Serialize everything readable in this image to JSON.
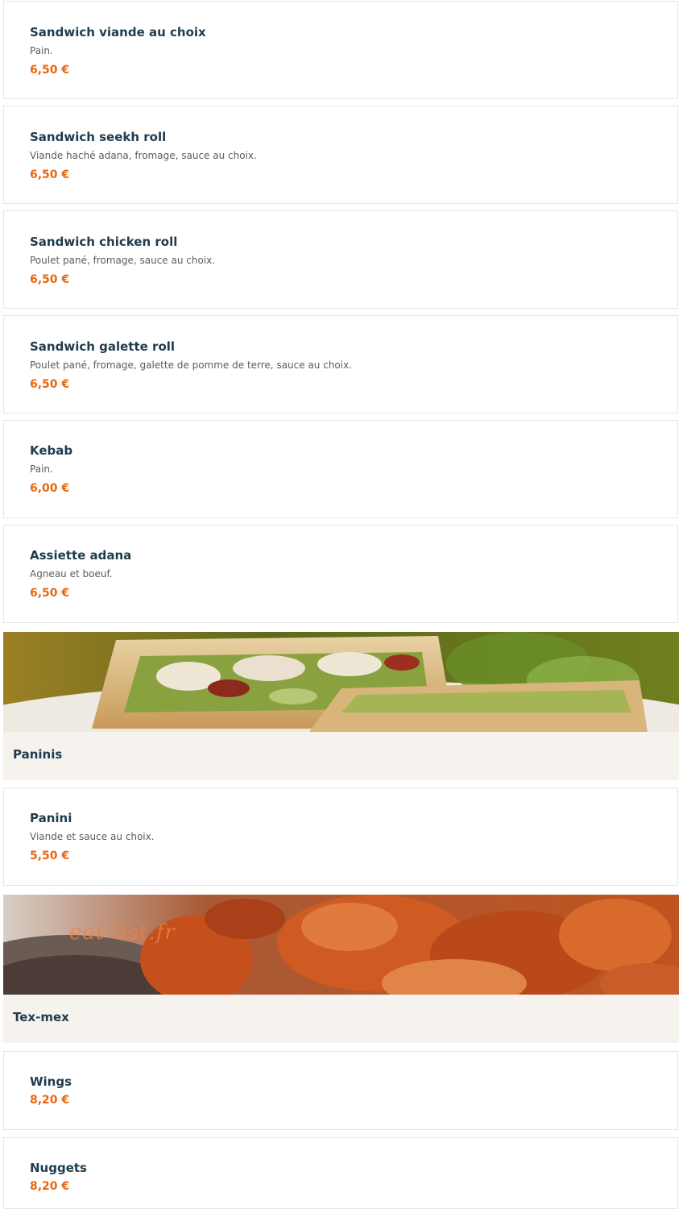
{
  "items": [
    {
      "name": "Sandwich viande au choix",
      "description": "Pain.",
      "price": "6,50 €"
    },
    {
      "name": "Sandwich seekh roll",
      "description": "Viande haché adana, fromage, sauce au choix.",
      "price": "6,50 €"
    },
    {
      "name": "Sandwich chicken roll",
      "description": "Poulet pané, fromage, sauce au choix.",
      "price": "6,50 €"
    },
    {
      "name": "Sandwich galette roll",
      "description": "Poulet pané, fromage, galette de pomme de terre, sauce au choix.",
      "price": "6,50 €"
    },
    {
      "name": "Kebab",
      "description": "Pain.",
      "price": "6,00 €"
    },
    {
      "name": "Assiette adana",
      "description": "Agneau et boeuf.",
      "price": "6,50 €"
    }
  ],
  "sections": [
    {
      "title": "Paninis",
      "image": "panini-photo",
      "items": [
        {
          "name": "Panini",
          "description": "Viande et sauce au choix.",
          "price": "5,50 €"
        }
      ]
    },
    {
      "title": "Tex-mex",
      "image": "chicken-wings-photo",
      "watermark": "eat-list.fr",
      "items": [
        {
          "name": "Wings",
          "price": "8,20 €"
        },
        {
          "name": "Nuggets",
          "price": "8,20 €"
        }
      ]
    }
  ],
  "colors": {
    "title": "#1f3b4d",
    "price": "#e8670f",
    "description": "#5c5c5c",
    "section_bg": "#f6f3ef"
  }
}
